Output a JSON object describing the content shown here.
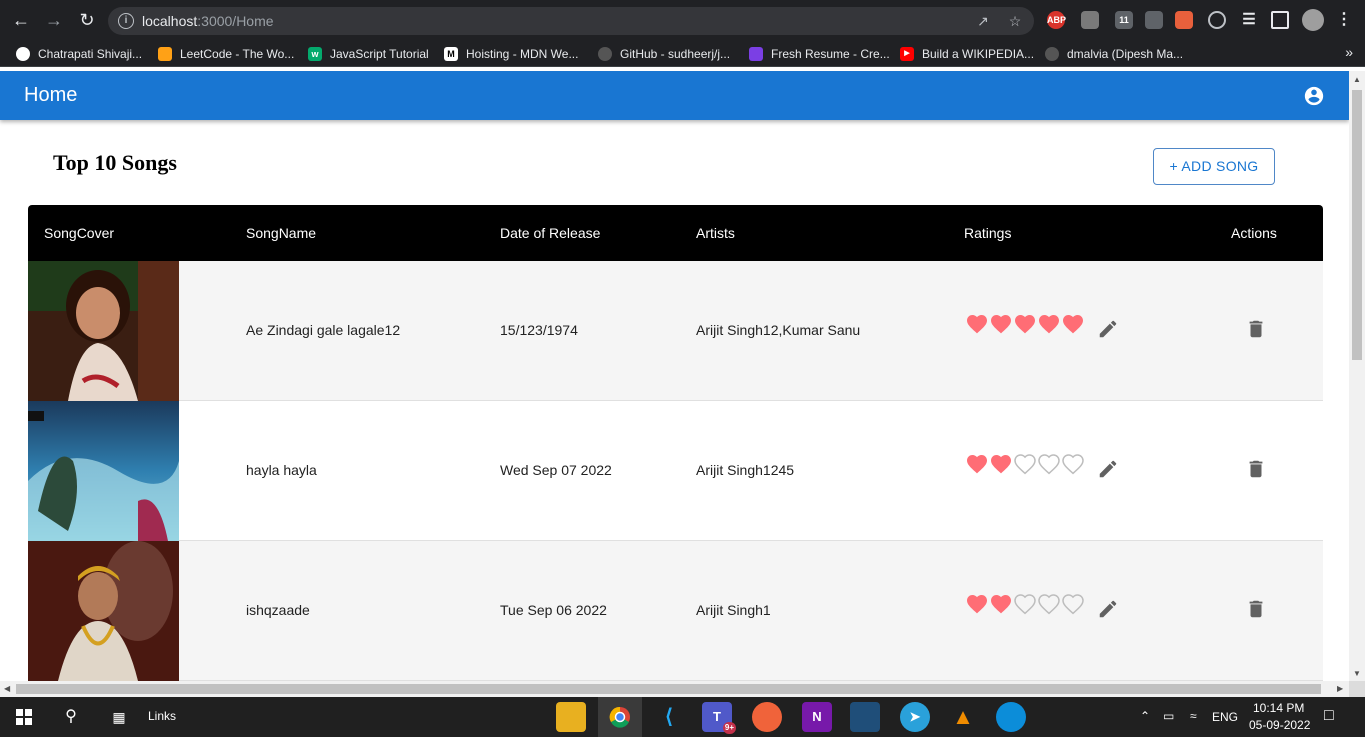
{
  "browser": {
    "url_host": "localhost",
    "url_path": ":3000/Home",
    "extensions": {
      "abp_label": "ABP",
      "badge_count": "11"
    }
  },
  "bookmarks": [
    {
      "label": "Chatrapati Shivaji...",
      "color": "#ffffff",
      "icon": "globe-icon"
    },
    {
      "label": "LeetCode - The Wo...",
      "color": "#ffa116",
      "icon": "leetcode-icon"
    },
    {
      "label": "JavaScript Tutorial",
      "color": "#04aa6d",
      "icon": "w3schools-icon"
    },
    {
      "label": "Hoisting - MDN We...",
      "color": "#ffffff",
      "icon": "mdn-icon"
    },
    {
      "label": "GitHub - sudheerj/j...",
      "color": "#555555",
      "icon": "github-icon"
    },
    {
      "label": "Fresh Resume - Cre...",
      "color": "#7b3fe4",
      "icon": "resume-icon"
    },
    {
      "label": "Build a WIKIPEDIA...",
      "color": "#ff0000",
      "icon": "youtube-icon"
    },
    {
      "label": "dmalvia (Dipesh Ma...",
      "color": "#555555",
      "icon": "github-icon"
    }
  ],
  "appbar": {
    "title": "Home"
  },
  "page": {
    "title": "Top 10 Songs",
    "add_song_label": "+ ADD SONG"
  },
  "table": {
    "headers": {
      "cover": "SongCover",
      "name": "SongName",
      "date": "Date of Release",
      "artists": "Artists",
      "ratings": "Ratings",
      "actions": "Actions"
    },
    "rows": [
      {
        "name": "Ae Zindagi gale lagale12",
        "date": "15/123/1974",
        "artists": "Arijit Singh12,Kumar Sanu",
        "rating": 5,
        "max_rating": 5
      },
      {
        "name": "hayla hayla",
        "date": "Wed Sep 07 2022",
        "artists": "Arijit Singh1245",
        "rating": 2,
        "max_rating": 5
      },
      {
        "name": "ishqzaade",
        "date": "Tue Sep 06 2022",
        "artists": "Arijit Singh1",
        "rating": 2,
        "max_rating": 5
      }
    ]
  },
  "taskbar": {
    "links_label": "Links",
    "teams_badge": "9+",
    "language": "ENG",
    "time": "10:14 PM",
    "date": "05-09-2022"
  },
  "colors": {
    "appbar": "#1976d2",
    "heart_filled": "#ff6d75",
    "heart_empty": "#bdbdbd",
    "table_header": "#000000"
  }
}
